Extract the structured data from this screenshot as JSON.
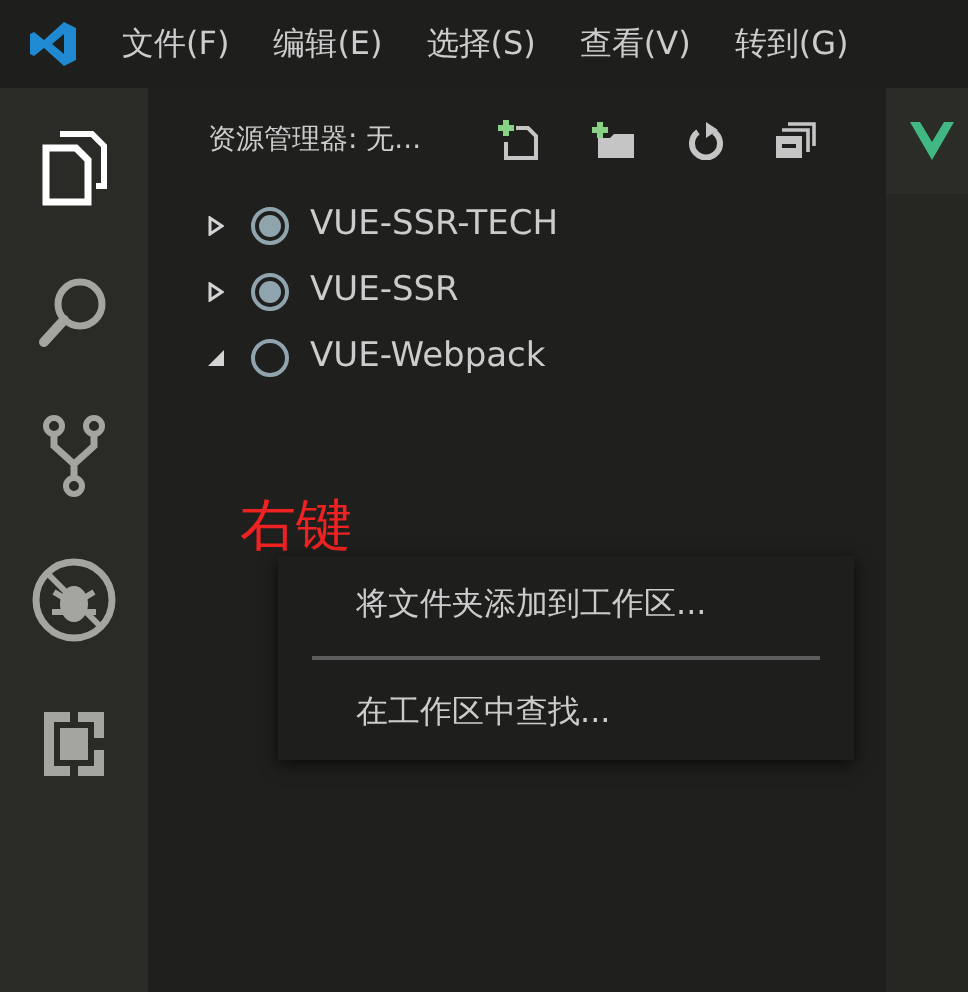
{
  "menu_bar": {
    "items": [
      "文件(F)",
      "编辑(E)",
      "选择(S)",
      "查看(V)",
      "转到(G)"
    ]
  },
  "activity_bar": {
    "items": [
      {
        "kind": "files",
        "selected": true
      },
      {
        "kind": "search",
        "selected": false
      },
      {
        "kind": "git",
        "selected": false
      },
      {
        "kind": "debug",
        "selected": false
      },
      {
        "kind": "extensions",
        "selected": false
      }
    ]
  },
  "sidebar": {
    "title": "资源管理器: 无...",
    "tree": [
      {
        "label": "VUE-SSR-TECH",
        "expanded": false,
        "checked": true
      },
      {
        "label": "VUE-SSR",
        "expanded": false,
        "checked": true
      },
      {
        "label": "VUE-Webpack",
        "expanded": true,
        "checked": false
      }
    ]
  },
  "annotation": "右键",
  "context_menu": {
    "items": [
      {
        "kind": "item",
        "label": "将文件夹添加到工作区..."
      },
      {
        "kind": "separator"
      },
      {
        "kind": "item",
        "label": "在工作区中查找..."
      }
    ]
  }
}
